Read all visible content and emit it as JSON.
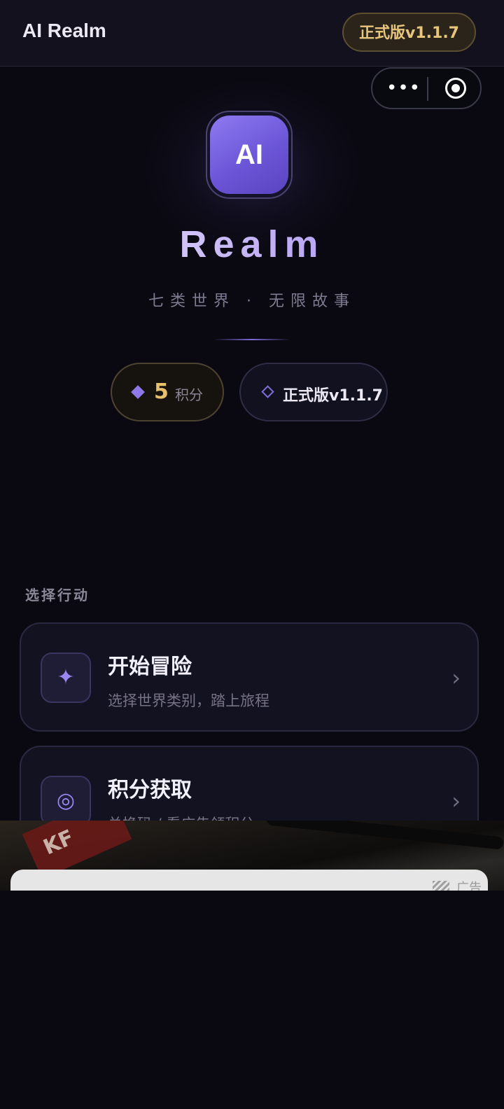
{
  "header": {
    "title": "AI Realm",
    "version_chip": "正式版v1.1.7"
  },
  "capsule": {
    "more_icon": "more-dots-icon",
    "close_icon": "target-circle-icon",
    "more_glyph": "•••"
  },
  "hero": {
    "logo_text": "AI",
    "brand": "Realm",
    "tagline": "七类世界 · 无限故事"
  },
  "stats": {
    "points_value": "5",
    "points_unit": "积分",
    "version_label": "正式版v1.1.7"
  },
  "actions": {
    "section_title": "选择行动",
    "items": [
      {
        "title": "开始冒险",
        "desc": "选择世界类别，踏上旅程",
        "icon": "sparkle-icon",
        "glyph": "✦",
        "chevron": "›"
      },
      {
        "title": "积分获取",
        "desc": "兑换码 / 看广告领积分",
        "icon": "concentric-circle-icon",
        "glyph": "◎",
        "chevron": "›"
      }
    ]
  },
  "ad": {
    "tag": "广告",
    "red_text": "KF"
  },
  "colors": {
    "background": "#0a0911",
    "accent_purple": "#8e7af0",
    "gold": "#e6c16a"
  }
}
